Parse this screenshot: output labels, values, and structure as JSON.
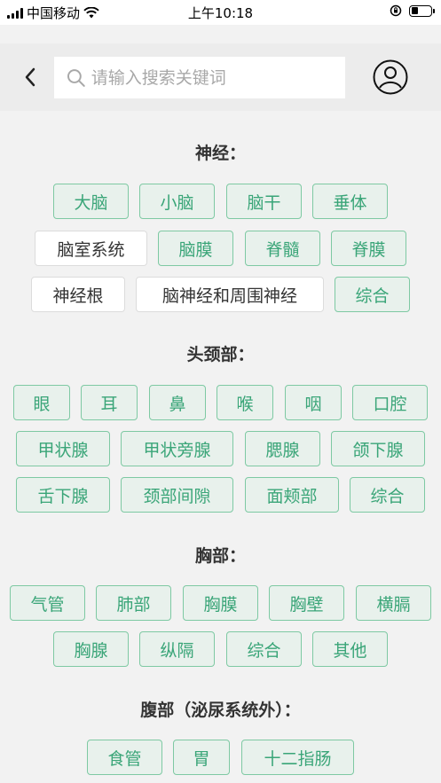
{
  "status": {
    "carrier": "中国移动",
    "time": "上午10:18"
  },
  "search": {
    "placeholder": "请输入搜索关键词"
  },
  "sections": [
    {
      "title": "神经：",
      "tags": [
        {
          "label": "大脑"
        },
        {
          "label": "小脑"
        },
        {
          "label": "脑干"
        },
        {
          "label": "垂体"
        },
        {
          "label": "脑室系统"
        },
        {
          "label": "脑膜"
        },
        {
          "label": "脊髓"
        },
        {
          "label": "脊膜"
        },
        {
          "label": "神经根"
        },
        {
          "label": "脑神经和周围神经"
        },
        {
          "label": "综合"
        }
      ]
    },
    {
      "title": "头颈部：",
      "tags": [
        {
          "label": "眼"
        },
        {
          "label": "耳"
        },
        {
          "label": "鼻"
        },
        {
          "label": "喉"
        },
        {
          "label": "咽"
        },
        {
          "label": "口腔"
        },
        {
          "label": "甲状腺"
        },
        {
          "label": "甲状旁腺"
        },
        {
          "label": "腮腺"
        },
        {
          "label": "颌下腺"
        },
        {
          "label": "舌下腺"
        },
        {
          "label": "颈部间隙"
        },
        {
          "label": "面颊部"
        },
        {
          "label": "综合"
        }
      ]
    },
    {
      "title": "胸部：",
      "tags": [
        {
          "label": "气管"
        },
        {
          "label": "肺部"
        },
        {
          "label": "胸膜"
        },
        {
          "label": "胸壁"
        },
        {
          "label": "横膈"
        },
        {
          "label": "胸腺"
        },
        {
          "label": "纵隔"
        },
        {
          "label": "综合"
        },
        {
          "label": "其他"
        }
      ]
    },
    {
      "title": "腹部（泌尿系统外）：",
      "tags": [
        {
          "label": "食管"
        },
        {
          "label": "胃"
        },
        {
          "label": "十二指肠"
        }
      ]
    }
  ],
  "colors": {
    "accent": "#3aa578",
    "tag_bg": "#e8f1ec",
    "tag_border": "#7ec9a3"
  },
  "icons": {
    "back": "chevron-left-icon",
    "search": "search-icon",
    "user": "user-circle-icon",
    "wifi": "wifi-icon",
    "battery": "battery-icon",
    "lock": "orientation-lock-icon"
  }
}
